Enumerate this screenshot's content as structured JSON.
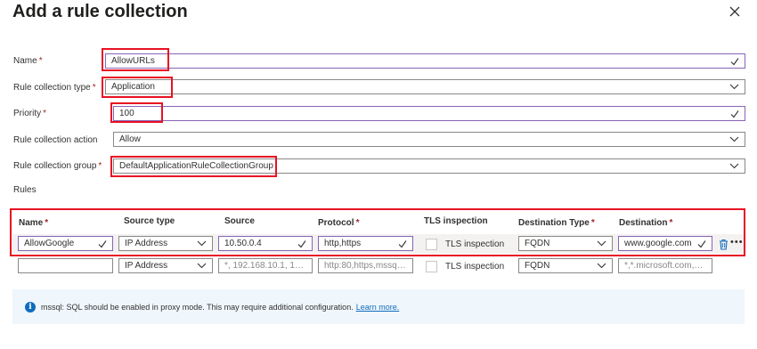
{
  "dialog": {
    "title": "Add a rule collection"
  },
  "form": {
    "name": {
      "label": "Name",
      "required": "*",
      "value": "AllowURLs"
    },
    "type": {
      "label": "Rule collection type",
      "required": "*",
      "value": "Application"
    },
    "priority": {
      "label": "Priority",
      "required": "*",
      "value": "100"
    },
    "action": {
      "label": "Rule collection action",
      "value": "Allow"
    },
    "group": {
      "label": "Rule collection group",
      "required": "*",
      "value": "DefaultApplicationRuleCollectionGroup"
    }
  },
  "rules": {
    "section_label": "Rules",
    "headers": {
      "name": "Name",
      "source_type": "Source type",
      "source": "Source",
      "protocol": "Protocol",
      "tls": "TLS inspection",
      "dest_type": "Destination Type",
      "destination": "Destination",
      "required": "*"
    },
    "row1": {
      "name": "AllowGoogle",
      "source_type": "IP Address",
      "source": "10.50.0.4",
      "protocol": "http,https",
      "tls": "TLS inspection",
      "dest_type": "FQDN",
      "destination": "www.google.com"
    },
    "row2": {
      "name": "",
      "source_type": "IP Address",
      "source_placeholder": "*, 192.168.10.1, 192....",
      "protocol_placeholder": "http:80,https,mssql:...",
      "tls": "TLS inspection",
      "dest_type": "FQDN",
      "destination_placeholder": "*,*.microsoft.com,*...."
    }
  },
  "info": {
    "icon": "i",
    "text": "mssql: SQL should be enabled in proxy mode. This may require additional configuration.",
    "link": "Learn more."
  },
  "colors": {
    "required": "#a4262c",
    "highlight": "#e81123",
    "focus_border": "#8764b8",
    "link": "#0f6cbd"
  }
}
